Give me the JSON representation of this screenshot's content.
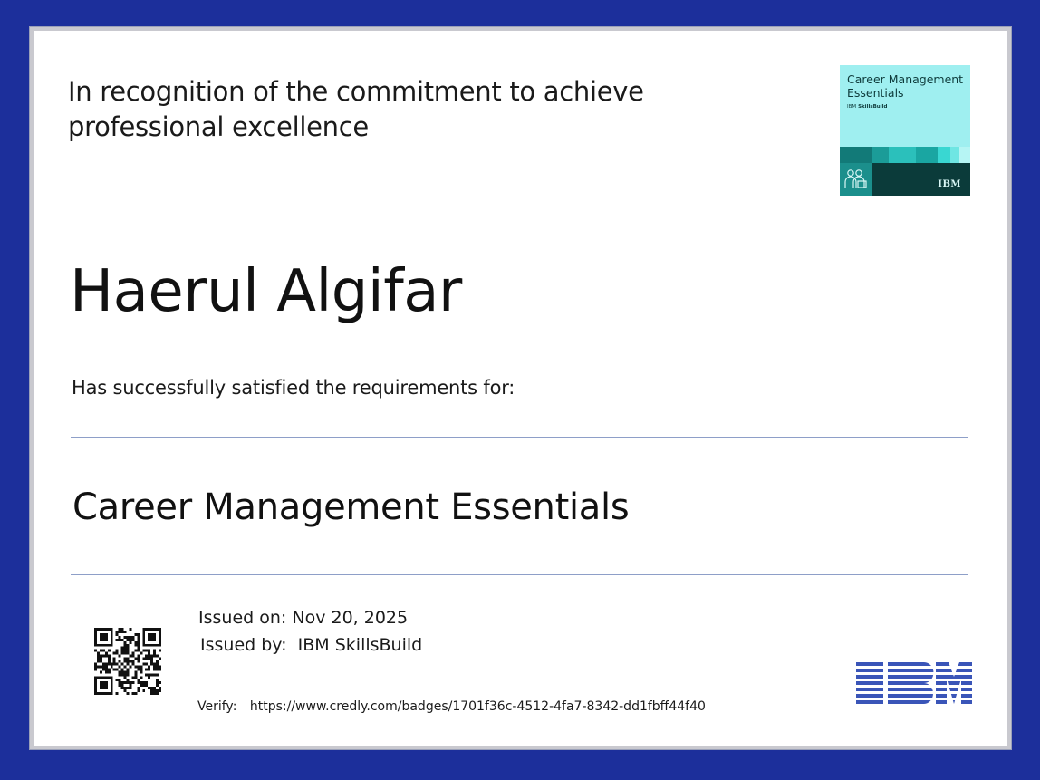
{
  "certificate": {
    "recognition_line1": "In recognition of the commitment to achieve",
    "recognition_line2": "professional excellence",
    "recipient_name": "Haerul Algifar",
    "satisfied_text": "Has successfully satisfied the requirements for:",
    "course_title": "Career Management Essentials",
    "issued_on_label": "Issued on:",
    "issued_on_value": "Nov 20, 2025",
    "issued_by_label": "Issued by:",
    "issued_by_value": "IBM SkillsBuild",
    "verify_label": "Verify:",
    "verify_url": "https://www.credly.com/badges/1701f36c-4512-4fa7-8342-dd1fbff44f40"
  },
  "badge": {
    "title": "Career Management Essentials",
    "brand_prefix": "IBM",
    "brand_name": "SkillsBuild",
    "corner_logo": "IBM",
    "icon": "people-icon"
  },
  "logo": {
    "name": "IBM",
    "icon": "ibm-logo"
  },
  "colors": {
    "frame": "#1c2f9b",
    "badge_background": "#9feff0",
    "badge_dark": "#0b3b3a",
    "ibm_blue": "#3a55b8",
    "rule": "#8e9fc8"
  }
}
